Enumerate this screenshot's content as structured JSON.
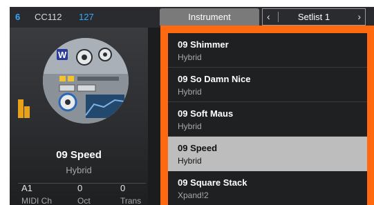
{
  "topbar": {
    "channel": "6",
    "cc_label": "CC112",
    "cc_value": "127",
    "tab_instrument": "Instrument",
    "setlist": "Setlist 1",
    "prev_icon": "chevron-left-icon",
    "next_icon": "chevron-right-icon"
  },
  "current": {
    "name": "09 Speed",
    "category": "Hybrid",
    "meter_icon": "level-meter-icon",
    "accent_color": "#e8a21a"
  },
  "stats": [
    {
      "value": "A1",
      "label": "MIDI Ch"
    },
    {
      "value": "0",
      "label": "Oct"
    },
    {
      "value": "0",
      "label": "Trans"
    }
  ],
  "presets": [
    {
      "name": "09 Shimmer",
      "category": "Hybrid"
    },
    {
      "name": "09 So Damn Nice",
      "category": "Hybrid"
    },
    {
      "name": "09 Soft Maus",
      "category": "Hybrid"
    },
    {
      "name": "09 Speed",
      "category": "Hybrid",
      "selected": true
    },
    {
      "name": "09 Square Stack",
      "category": "Xpand!2"
    }
  ],
  "colors": {
    "highlight_frame": "#ff6a10",
    "channel_blue": "#33aaff",
    "selected_row": "#bdbdbd"
  }
}
